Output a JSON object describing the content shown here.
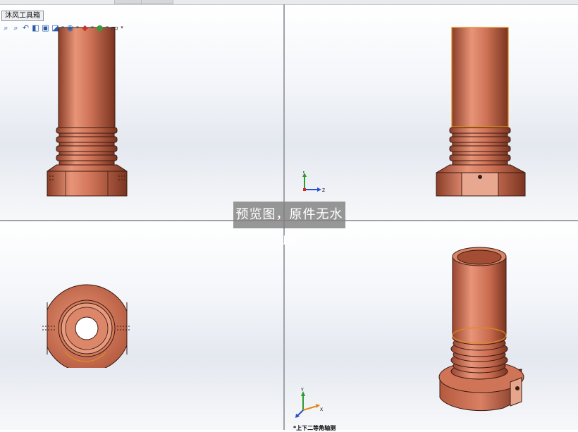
{
  "toolbox": {
    "tab_label": "沐风工具箱"
  },
  "heads_up_toolbar": {
    "icons": [
      "zoom-to-fit-icon",
      "zoom-to-area-icon",
      "previous-view-icon",
      "section-view-icon",
      "view-orientation-icon",
      "display-style-icon",
      "hide-show-items-icon",
      "edit-appearance-icon",
      "apply-scene-icon",
      "view-settings-icon"
    ]
  },
  "watermark": {
    "text": "预览图，原件无水印"
  },
  "triad": {
    "x_label": "X",
    "y_label": "Y",
    "z_label": "Z"
  },
  "bottom_right_view": {
    "partial_label": "*上下二等角轴测"
  },
  "colors": {
    "part": "#c46a4e",
    "edge": "#3a1a12",
    "highlight": "#e08a1a",
    "axis_x": "#d12e1f",
    "axis_y": "#2e9a2e",
    "axis_z": "#2a4fd0"
  }
}
